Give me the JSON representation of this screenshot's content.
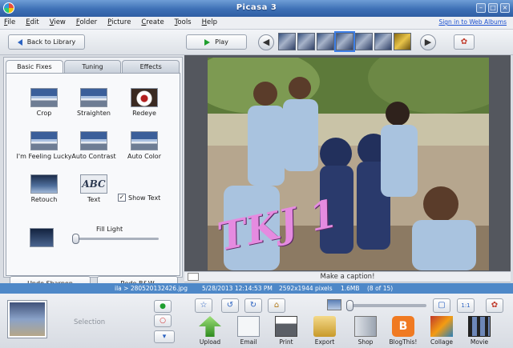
{
  "window": {
    "title": "Picasa 3"
  },
  "menu": {
    "items": [
      "File",
      "Edit",
      "View",
      "Folder",
      "Picture",
      "Create",
      "Tools",
      "Help"
    ],
    "signin": "Sign in to Web Albums"
  },
  "toolbar": {
    "back_label": "Back to Library",
    "play_label": "Play"
  },
  "tabs": [
    {
      "label": "Basic Fixes",
      "active": true
    },
    {
      "label": "Tuning",
      "active": false
    },
    {
      "label": "Effects",
      "active": false
    }
  ],
  "tools": {
    "crop": "Crop",
    "straighten": "Straighten",
    "redeye": "Redeye",
    "lucky": "I'm Feeling Lucky",
    "auto_contrast": "Auto Contrast",
    "auto_color": "Auto Color",
    "retouch": "Retouch",
    "text": "Text",
    "text_icon": "ABC",
    "show_text": "Show Text",
    "fill_light": "Fill Light"
  },
  "panel_buttons": {
    "undo": "Undo Sharpen",
    "redo": "Redo B&W"
  },
  "photo": {
    "overlay_text": "TKJ 1"
  },
  "caption": {
    "placeholder": "Make a caption!"
  },
  "info": {
    "path": "ila > 280520132426.jpg",
    "datetime": "5/28/2013 12:14:53 PM",
    "dimensions": "2592x1944 pixels",
    "size": "1.6MB",
    "position": "(8 of 15)"
  },
  "tray": {
    "selection_label": "Selection",
    "actions": [
      "Upload",
      "Email",
      "Print",
      "Export",
      "Shop",
      "BlogThis!",
      "Collage",
      "Movie"
    ]
  },
  "colors": {
    "titlebar": "#3d6fb5",
    "infobar": "#4e88c8",
    "overlay_text": "#e58be0"
  }
}
